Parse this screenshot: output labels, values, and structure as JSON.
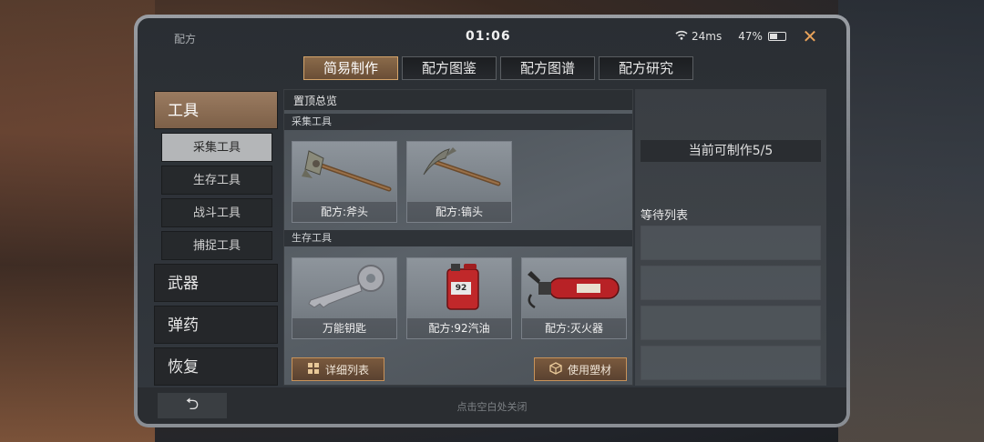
{
  "status": {
    "title": "配方",
    "time": "01:06",
    "signal": "24ms",
    "battery": "47%"
  },
  "tabs": [
    {
      "label": "简易制作",
      "active": true
    },
    {
      "label": "配方图鉴",
      "active": false
    },
    {
      "label": "配方图谱",
      "active": false
    },
    {
      "label": "配方研究",
      "active": false
    }
  ],
  "sidebar": {
    "categories": [
      "工具",
      "武器",
      "弹药",
      "恢复"
    ],
    "subcategories": [
      "采集工具",
      "生存工具",
      "战斗工具",
      "捕捉工具"
    ]
  },
  "content": {
    "header": "置顶总览",
    "sections": [
      {
        "title": "采集工具",
        "items": [
          "配方:斧头",
          "配方:镐头"
        ]
      },
      {
        "title": "生存工具",
        "items": [
          "万能钥匙",
          "配方:92汽油",
          "配方:灭火器"
        ]
      }
    ],
    "fuel_label": "92",
    "buttons": {
      "details": "详细列表",
      "use_material": "使用塑材"
    }
  },
  "right_panel": {
    "craftable": "当前可制作5/5",
    "queue_title": "等待列表"
  },
  "bottom": {
    "close_hint": "点击空白处关闭"
  },
  "colors": {
    "accent": "#d4a46a",
    "active_tab": "#7a5a3e",
    "close": "#e8a25a"
  }
}
